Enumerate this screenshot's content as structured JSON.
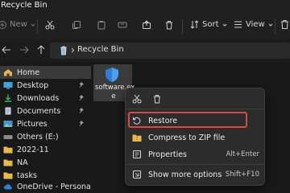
{
  "window": {
    "title": "Recycle Bin"
  },
  "toolbar": {
    "new_label": "New",
    "sort_label": "Sort",
    "view_label": "View"
  },
  "address": {
    "path": "Recycle Bin"
  },
  "sidebar": {
    "items": [
      {
        "label": "Home"
      },
      {
        "label": "Desktop"
      },
      {
        "label": "Downloads"
      },
      {
        "label": "Documents"
      },
      {
        "label": "Pictures"
      },
      {
        "label": "Others (E:)"
      },
      {
        "label": "2022-11"
      },
      {
        "label": "NA"
      },
      {
        "label": "tasks"
      },
      {
        "label": "OneDrive - Personal"
      }
    ]
  },
  "file": {
    "name_line1": "software.ex",
    "name_line2": "e"
  },
  "context_menu": {
    "items": [
      {
        "label": "Restore",
        "shortcut": ""
      },
      {
        "label": "Compress to ZIP file",
        "shortcut": ""
      },
      {
        "label": "Properties",
        "shortcut": "Alt+Enter"
      },
      {
        "label": "Show more options",
        "shortcut": "Shift+F10"
      }
    ]
  },
  "colors": {
    "highlight_border": "#d84a4a",
    "folder_yellow": "#e8b84a",
    "accent_blue": "#2f7fd8"
  }
}
